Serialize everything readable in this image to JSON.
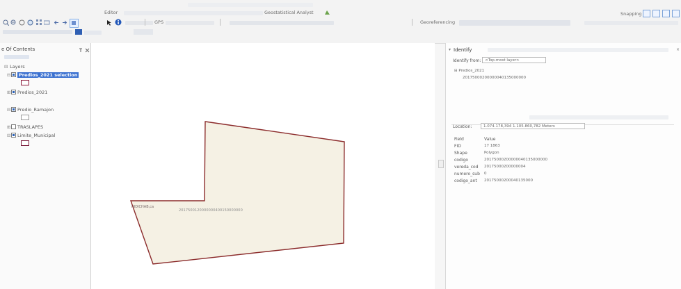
{
  "toolbar": {
    "editor_label": "Editor",
    "geostatistical_label": "Geostatistical Analyst",
    "georeferencing_label": "Georeferencing",
    "snapping_label": "Snapping",
    "gps_label": "GPS"
  },
  "toc": {
    "title": "e Of Contents",
    "root_label": "Layers",
    "layers": [
      {
        "label": "Predios_2021 selection",
        "checked": true,
        "selected": true
      },
      {
        "label": "Predios_2021",
        "checked": true
      },
      {
        "label": "Predio_Ramajon",
        "checked": true
      },
      {
        "label": "TRASLAPES",
        "checked": false
      },
      {
        "label": "Limite_Municipal",
        "checked": true
      }
    ]
  },
  "map": {
    "parcel_label_left": "HIDICHAB,ca",
    "parcel_label_center": "2017500120000000400150000000",
    "fill_color": "#f5f1e4",
    "outline_color": "#8b2b2b"
  },
  "identify": {
    "title": "Identify",
    "identify_from_label": "Identify from:",
    "identify_from_value": "<Top-most layer>",
    "tree_layer": "Predios_2021",
    "tree_feature": "20175000200000040135000000",
    "location_label": "Location:",
    "location_value": "1.074.178,394  1.105.860,782 Meters",
    "field_header": "Field",
    "value_header": "Value",
    "rows": [
      {
        "field": "FID",
        "value": "17 1863"
      },
      {
        "field": "Shape",
        "value": "Polygon"
      },
      {
        "field": "codigo",
        "value": "20175000200000040135000000"
      },
      {
        "field": "vereda_cod",
        "value": "20175000200000004"
      },
      {
        "field": "numero_sub",
        "value": "0"
      },
      {
        "field": "codigo_ant",
        "value": "20175000200040135000"
      }
    ]
  }
}
